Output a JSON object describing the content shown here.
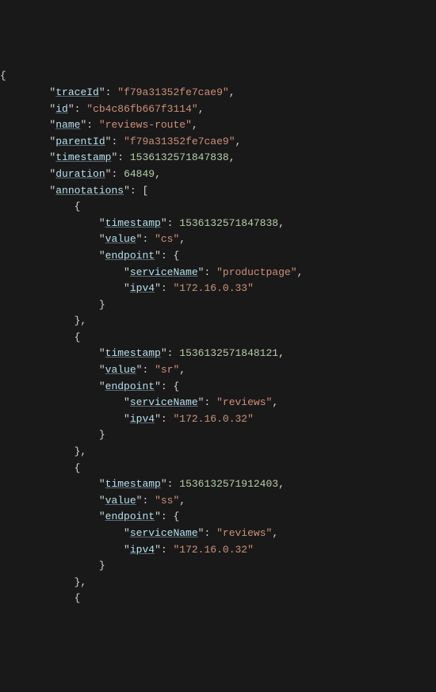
{
  "keys": {
    "traceId": "traceId",
    "id": "id",
    "name": "name",
    "parentId": "parentId",
    "timestamp": "timestamp",
    "duration": "duration",
    "annotations": "annotations",
    "value": "value",
    "endpoint": "endpoint",
    "serviceName": "serviceName",
    "ipv4": "ipv4"
  },
  "trace": {
    "traceId": "f79a31352fe7cae9",
    "id": "cb4c86fb667f3114",
    "name": "reviews-route",
    "parentId": "f79a31352fe7cae9",
    "timestamp": 1536132571847838,
    "duration": 64849,
    "annotations": [
      {
        "timestamp": 1536132571847838,
        "value": "cs",
        "endpoint": {
          "serviceName": "productpage",
          "ipv4": "172.16.0.33"
        }
      },
      {
        "timestamp": 1536132571848121,
        "value": "sr",
        "endpoint": {
          "serviceName": "reviews",
          "ipv4": "172.16.0.32"
        }
      },
      {
        "timestamp": 1536132571912403,
        "value": "ss",
        "endpoint": {
          "serviceName": "reviews",
          "ipv4": "172.16.0.32"
        }
      }
    ]
  },
  "indent": {
    "i1": "    ",
    "i2": "        ",
    "i3": "            ",
    "i4": "                ",
    "i5": "                    "
  }
}
